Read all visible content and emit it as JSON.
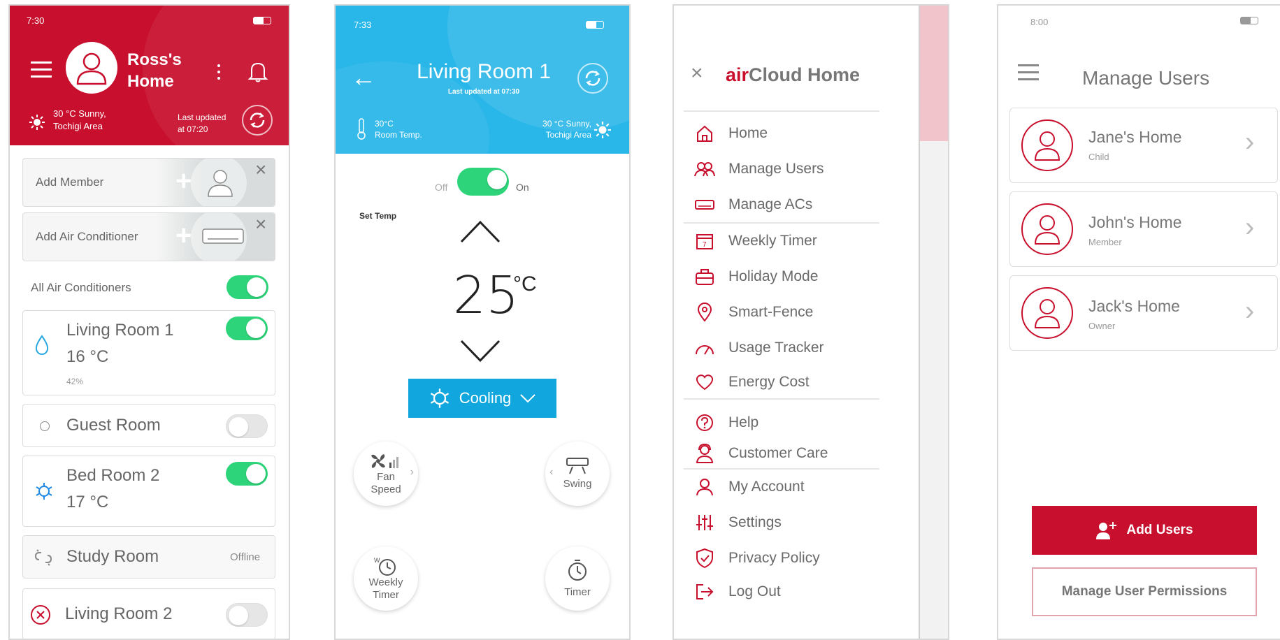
{
  "colors": {
    "brand_red": "#c8102e",
    "sky_blue": "#29b6e8",
    "toggle_green": "#2ed47a"
  },
  "screen1": {
    "time": "7:30",
    "home_title_line1": "Ross's",
    "home_title_line2": "Home",
    "weather_line1": "30 °C Sunny,",
    "weather_line2": "Tochigi Area",
    "updated_line1": "Last updated",
    "updated_line2": "at 07:20",
    "add_member": "Add Member",
    "add_ac": "Add Air Conditioner",
    "all_acs": "All Air Conditioners",
    "rooms": [
      {
        "name": "Living Room 1",
        "temp": "16 °C",
        "humidity": "42%",
        "state": "on",
        "icon": "drop-icon"
      },
      {
        "name": "Guest Room",
        "state": "off",
        "icon": "circle-icon"
      },
      {
        "name": "Bed Room 2",
        "temp": "17 °C",
        "state": "on",
        "icon": "snowflake-icon"
      },
      {
        "name": "Study Room",
        "status": "Offline",
        "icon": "unlinked-icon"
      },
      {
        "name": "Living Room 2",
        "state": "off",
        "icon": "error-icon"
      }
    ]
  },
  "screen2": {
    "time": "7:33",
    "room_title": "Living Room 1",
    "last_updated": "Last updated at 07:30",
    "room_temp_value": "30°C",
    "room_temp_label": "Room Temp.",
    "weather_line1": "30 °C Sunny,",
    "weather_line2": "Tochigi Area",
    "off_label": "Off",
    "on_label": "On",
    "power_on": true,
    "set_temp_label": "Set Temp",
    "set_temp_value": "25",
    "set_temp_unit": "°C",
    "mode": "Cooling",
    "fan_speed_line1": "Fan",
    "fan_speed_line2": "Speed",
    "swing": "Swing",
    "weekly_timer_line1": "Weekly",
    "weekly_timer_line2": "Timer",
    "timer": "Timer"
  },
  "screen3": {
    "brand_prefix": "air",
    "brand_suffix": "Cloud Home",
    "menu": [
      {
        "label": "Home",
        "icon": "home-icon"
      },
      {
        "label": "Manage Users",
        "icon": "users-icon"
      },
      {
        "label": "Manage ACs",
        "icon": "ac-icon"
      },
      {
        "label": "Weekly Timer",
        "icon": "calendar-icon"
      },
      {
        "label": "Holiday Mode",
        "icon": "luggage-icon"
      },
      {
        "label": "Smart-Fence",
        "icon": "location-pin-icon"
      },
      {
        "label": "Usage Tracker",
        "icon": "gauge-icon"
      },
      {
        "label": "Energy Cost",
        "icon": "heart-icon"
      },
      {
        "label": "Help",
        "icon": "help-icon"
      },
      {
        "label": "Customer Care",
        "icon": "support-agent-icon"
      },
      {
        "label": "My Account",
        "icon": "user-icon"
      },
      {
        "label": "Settings",
        "icon": "sliders-icon"
      },
      {
        "label": "Privacy Policy",
        "icon": "shield-icon"
      },
      {
        "label": "Log Out",
        "icon": "logout-icon"
      }
    ]
  },
  "screen4": {
    "time": "8:00",
    "title": "Manage Users",
    "users": [
      {
        "name": "Jane's Home",
        "role": "Child"
      },
      {
        "name": "John's Home",
        "role": "Member"
      },
      {
        "name": "Jack's Home",
        "role": "Owner"
      }
    ],
    "add_users": "Add Users",
    "manage_permissions": "Manage User Permissions"
  }
}
